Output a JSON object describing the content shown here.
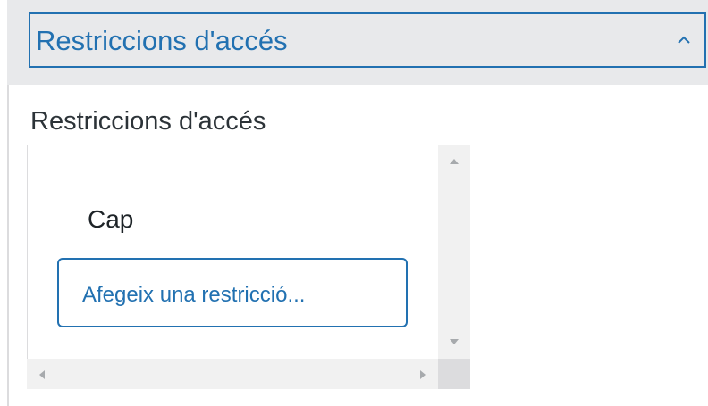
{
  "section": {
    "header_title": "Restriccions d'accés",
    "panel_title": "Restriccions d'accés",
    "expanded": true
  },
  "restrictions": {
    "current_value": "Cap",
    "add_button_label": "Afegeix una restricció..."
  },
  "icons": {
    "collapse": "chevron-up-icon",
    "scroll_up": "scroll-up-arrow-icon",
    "scroll_down": "scroll-down-arrow-icon",
    "scroll_left": "scroll-left-arrow-icon",
    "scroll_right": "scroll-right-arrow-icon"
  },
  "colors": {
    "accent": "#2271b1",
    "header_background": "#e8e9eb",
    "text": "#1d2327"
  }
}
